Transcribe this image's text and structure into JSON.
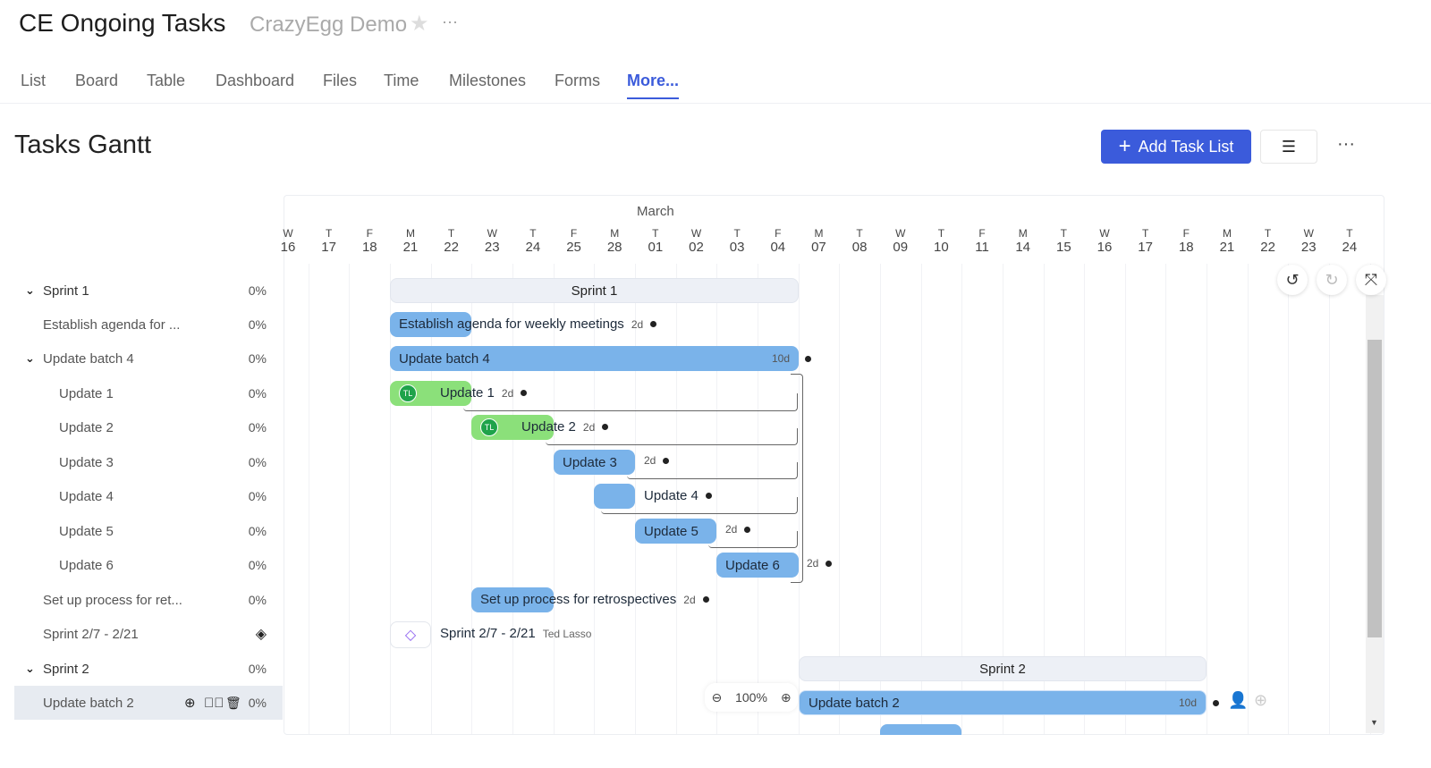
{
  "header": {
    "title": "CE Ongoing Tasks",
    "workspace": "CrazyEgg Demo"
  },
  "tabs": [
    "List",
    "Board",
    "Table",
    "Dashboard",
    "Files",
    "Time",
    "Milestones",
    "Forms",
    "More..."
  ],
  "active_tab": "More...",
  "page": {
    "title": "Tasks Gantt",
    "add_button": "Add Task List"
  },
  "timeline": {
    "month": "March",
    "days": [
      [
        "W",
        "16"
      ],
      [
        "T",
        "17"
      ],
      [
        "F",
        "18"
      ],
      [
        "M",
        "21"
      ],
      [
        "T",
        "22"
      ],
      [
        "W",
        "23"
      ],
      [
        "T",
        "24"
      ],
      [
        "F",
        "25"
      ],
      [
        "M",
        "28"
      ],
      [
        "T",
        "01"
      ],
      [
        "W",
        "02"
      ],
      [
        "T",
        "03"
      ],
      [
        "F",
        "04"
      ],
      [
        "M",
        "07"
      ],
      [
        "T",
        "08"
      ],
      [
        "W",
        "09"
      ],
      [
        "T",
        "10"
      ],
      [
        "F",
        "11"
      ],
      [
        "M",
        "14"
      ],
      [
        "T",
        "15"
      ],
      [
        "W",
        "16"
      ],
      [
        "T",
        "17"
      ],
      [
        "F",
        "18"
      ],
      [
        "M",
        "21"
      ],
      [
        "T",
        "22"
      ],
      [
        "W",
        "23"
      ],
      [
        "T",
        "24"
      ]
    ]
  },
  "tasks": [
    {
      "name": "Sprint 1",
      "pct": "0%"
    },
    {
      "name": "Establish agenda for ...",
      "pct": "0%"
    },
    {
      "name": "Update batch 4",
      "pct": "0%"
    },
    {
      "name": "Update 1",
      "pct": "0%"
    },
    {
      "name": "Update 2",
      "pct": "0%"
    },
    {
      "name": "Update 3",
      "pct": "0%"
    },
    {
      "name": "Update 4",
      "pct": "0%"
    },
    {
      "name": "Update 5",
      "pct": "0%"
    },
    {
      "name": "Update 6",
      "pct": "0%"
    },
    {
      "name": "Set up process for ret...",
      "pct": "0%"
    },
    {
      "name": "Sprint 2/7 - 2/21",
      "pct": ""
    },
    {
      "name": "Sprint 2",
      "pct": "0%"
    },
    {
      "name": "Update batch 2",
      "pct": "0%"
    }
  ],
  "bars": {
    "sprint1": "Sprint 1",
    "establish": "Establish agenda for weekly meetings",
    "establish_dur": "2d",
    "batch4": "Update batch 4",
    "batch4_dur": "10d",
    "u1": "Update 1",
    "u1_dur": "2d",
    "u2": "Update 2",
    "u2_dur": "2d",
    "u3": "Update 3",
    "u3_dur": "2d",
    "u4": "Update 4",
    "u5": "Update 5",
    "u5_dur": "2d",
    "u6": "Update 6",
    "u6_dur": "2d",
    "setup": "Set up process for retrospectives",
    "setup_dur": "2d",
    "milestone": "Sprint 2/7 - 2/21",
    "milestone_owner": "Ted Lasso",
    "sprint2": "Sprint 2",
    "batch2": "Update batch 2",
    "batch2_dur": "10d",
    "avatar": "TL"
  },
  "zoom": "100%"
}
